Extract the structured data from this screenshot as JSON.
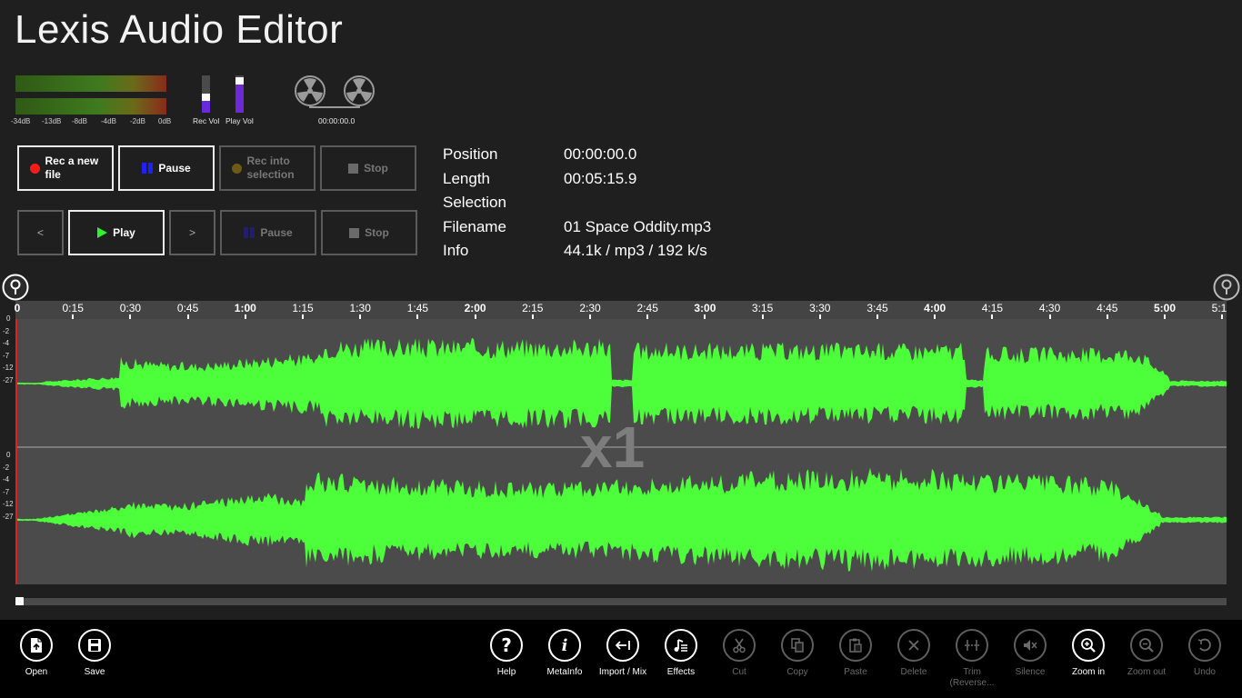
{
  "app_title": "Lexis Audio Editor",
  "meters": {
    "db_labels": [
      "-34dB",
      "-13dB",
      "-8dB",
      "-4dB",
      "-2dB",
      "0dB"
    ],
    "rec_vol_label": "Rec Vol",
    "play_vol_label": "Play Vol",
    "rec_vol_level": 0.35,
    "play_vol_level": 0.78,
    "reel_time": "00:00:00.0"
  },
  "record_row": {
    "rec_new_label": "Rec a new file",
    "pause_label": "Pause",
    "rec_selection_label": "Rec into selection",
    "stop_label": "Stop"
  },
  "play_row": {
    "prev_label": "<",
    "play_label": "Play",
    "next_label": ">",
    "pause_label": "Pause",
    "stop_label": "Stop"
  },
  "colors": {
    "rec_dot": "#ff1a1a",
    "pause_icon": "#2020ff",
    "play_icon": "#33ee33",
    "waveform": "#4dff3a",
    "cursor": "#e02020",
    "volume": "#6a2ad6"
  },
  "info": {
    "position_label": "Position",
    "position_value": "00:00:00.0",
    "length_label": "Length",
    "length_value": "00:05:15.9",
    "selection_label": "Selection",
    "selection_value": "",
    "filename_label": "Filename",
    "filename_value": "01 Space Oddity.mp3",
    "info_label": "Info",
    "info_value": "44.1k / mp3 / 192 k/s"
  },
  "timeline": {
    "total_seconds": 315.9,
    "ticks": [
      "0",
      "0:15",
      "0:30",
      "0:45",
      "1:00",
      "1:15",
      "1:30",
      "1:45",
      "2:00",
      "2:15",
      "2:30",
      "2:45",
      "3:00",
      "3:15",
      "3:30",
      "3:45",
      "4:00",
      "4:15",
      "4:30",
      "4:45",
      "5:00",
      "5:1"
    ]
  },
  "db_scale": [
    "0",
    "-2",
    "-4",
    "-7",
    "-12",
    "-27"
  ],
  "zoom_indicator": "x1",
  "appbar": {
    "open": "Open",
    "save": "Save",
    "help": "Help",
    "metainfo": "MetaInfo",
    "import_mix": "Import / Mix",
    "effects": "Effects",
    "cut": "Cut",
    "copy": "Copy",
    "paste": "Paste",
    "delete": "Delete",
    "trim": "Trim (Reverse...",
    "silence": "Silence",
    "zoom_in": "Zoom in",
    "zoom_out": "Zoom out",
    "undo": "Undo"
  }
}
